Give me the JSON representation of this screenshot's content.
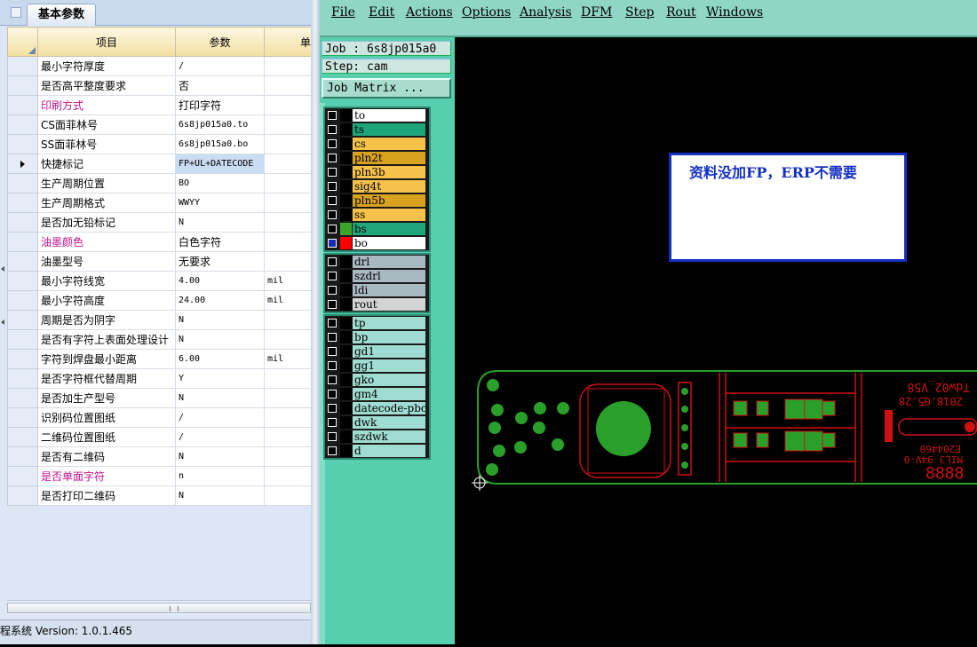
{
  "left_panel": {
    "tab_label": "基本参数",
    "columns": [
      "项目",
      "参数",
      "单"
    ],
    "rows": [
      {
        "name": "最小字符厚度",
        "value": "/",
        "unit": "",
        "pink": false
      },
      {
        "name": "是否高平整度要求",
        "value": "否",
        "unit": "",
        "pink": false
      },
      {
        "name": "印刷方式",
        "value": "打印字符",
        "unit": "",
        "pink": true
      },
      {
        "name": "CS面菲林号",
        "value": "6s8jp015a0.to",
        "unit": "",
        "pink": false
      },
      {
        "name": "SS面菲林号",
        "value": "6s8jp015a0.bo",
        "unit": "",
        "pink": false
      },
      {
        "name": "快捷标记",
        "value": "FP+UL+DATECODE",
        "unit": "",
        "pink": false,
        "current": true
      },
      {
        "name": "生产周期位置",
        "value": "BO",
        "unit": "",
        "pink": false
      },
      {
        "name": "生产周期格式",
        "value": "WWYY",
        "unit": "",
        "pink": false
      },
      {
        "name": "是否加无铅标记",
        "value": "N",
        "unit": "",
        "pink": false
      },
      {
        "name": "油墨颜色",
        "value": "白色字符",
        "unit": "",
        "pink": true
      },
      {
        "name": "油墨型号",
        "value": "无要求",
        "unit": "",
        "pink": false
      },
      {
        "name": "最小字符线宽",
        "value": "4.00",
        "unit": "mil",
        "pink": false
      },
      {
        "name": "最小字符高度",
        "value": "24.00",
        "unit": "mil",
        "pink": false
      },
      {
        "name": "周期是否为阴字",
        "value": "N",
        "unit": "",
        "pink": false
      },
      {
        "name": "是否有字符上表面处理设计",
        "value": "N",
        "unit": "",
        "pink": false
      },
      {
        "name": "字符到焊盘最小距离",
        "value": "6.00",
        "unit": "mil",
        "pink": false
      },
      {
        "name": "是否字符框代替周期",
        "value": "Y",
        "unit": "",
        "pink": false
      },
      {
        "name": "是否加生产型号",
        "value": "N",
        "unit": "",
        "pink": false
      },
      {
        "name": "识别码位置图纸",
        "value": "/",
        "unit": "",
        "pink": false
      },
      {
        "name": "二维码位置图纸",
        "value": "/",
        "unit": "",
        "pink": false
      },
      {
        "name": "是否有二维码",
        "value": "N",
        "unit": "",
        "pink": false
      },
      {
        "name": "是否单面字符",
        "value": "n",
        "unit": "",
        "pink": true
      },
      {
        "name": "是否打印二维码",
        "value": "N",
        "unit": "",
        "pink": false
      }
    ],
    "status_text": "程系统  Version: 1.0.1.465"
  },
  "cam": {
    "menu": [
      "File",
      "Edit",
      "Actions",
      "Options",
      "Analysis",
      "DFM",
      "Step",
      "Rout",
      "Windows"
    ],
    "job_label": "Job : 6s8jp015a0",
    "step_label": "Step: cam",
    "job_matrix_label": "Job Matrix ...",
    "layer_groups": [
      [
        {
          "name": "to",
          "color": "#ffffff",
          "swatch": "#000000",
          "checked": false
        },
        {
          "name": "ts",
          "color": "#1fa57a",
          "swatch": "#000000",
          "checked": false
        },
        {
          "name": "cs",
          "color": "#f7c24a",
          "swatch": "#000000",
          "checked": false
        },
        {
          "name": "pln2t",
          "color": "#d8a21f",
          "swatch": "#000000",
          "checked": false
        },
        {
          "name": "pln3b",
          "color": "#f7c24a",
          "swatch": "#000000",
          "checked": false
        },
        {
          "name": "sig4t",
          "color": "#f7c24a",
          "swatch": "#000000",
          "checked": false
        },
        {
          "name": "pln5b",
          "color": "#d8a21f",
          "swatch": "#000000",
          "checked": false
        },
        {
          "name": "ss",
          "color": "#f7c24a",
          "swatch": "#000000",
          "checked": false
        },
        {
          "name": "bs",
          "color": "#1fa57a",
          "swatch": "#3aa52a",
          "checked": false
        },
        {
          "name": "bo",
          "color": "#ffffff",
          "swatch": "#ff0000",
          "checked": true
        }
      ],
      [
        {
          "name": "drl",
          "color": "#a9b9c0",
          "swatch": "#000000",
          "checked": false
        },
        {
          "name": "szdrl",
          "color": "#a9b9c0",
          "swatch": "#000000",
          "checked": false
        },
        {
          "name": "ldi",
          "color": "#a9b9c0",
          "swatch": "#000000",
          "checked": false
        },
        {
          "name": "rout",
          "color": "#d4d4d4",
          "swatch": "#000000",
          "checked": false
        }
      ],
      [
        {
          "name": "tp",
          "color": "#9fdcd2",
          "swatch": "#000000",
          "checked": false
        },
        {
          "name": "bp",
          "color": "#9fdcd2",
          "swatch": "#000000",
          "checked": false
        },
        {
          "name": "gd1",
          "color": "#9fdcd2",
          "swatch": "#000000",
          "checked": false
        },
        {
          "name": "gg1",
          "color": "#9fdcd2",
          "swatch": "#000000",
          "checked": false
        },
        {
          "name": "gko",
          "color": "#9fdcd2",
          "swatch": "#000000",
          "checked": false
        },
        {
          "name": "gm4",
          "color": "#9fdcd2",
          "swatch": "#000000",
          "checked": false
        },
        {
          "name": "datecode-pbo",
          "color": "#9fdcd2",
          "swatch": "#000000",
          "checked": false
        },
        {
          "name": "dwk",
          "color": "#9fdcd2",
          "swatch": "#000000",
          "checked": false
        },
        {
          "name": "szdwk",
          "color": "#9fdcd2",
          "swatch": "#000000",
          "checked": false
        },
        {
          "name": "d",
          "color": "#9fdcd2",
          "swatch": "#000000",
          "checked": false
        }
      ]
    ],
    "note_text": "资料没加FP，ERP不需要",
    "board_texts": {
      "model": "Tdw02_V58",
      "date": "2018.05.28",
      "code": "E204460",
      "ul": "MIL3 94V-0",
      "cycle": "8888"
    }
  }
}
